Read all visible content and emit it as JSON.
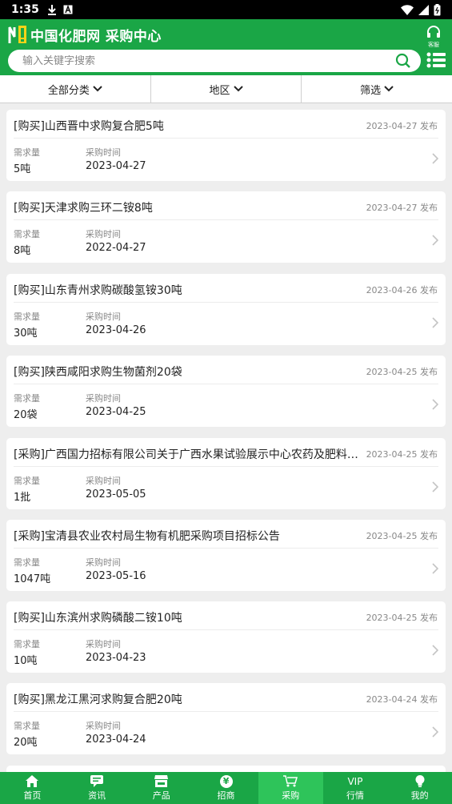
{
  "status": {
    "time": "1:35"
  },
  "header": {
    "title": "中国化肥网 采购中心",
    "service_label": "客服",
    "search_placeholder": "输入关键字搜索",
    "brand_color": "#1aa646"
  },
  "filters": [
    {
      "label": "全部分类"
    },
    {
      "label": "地区"
    },
    {
      "label": "筛选"
    }
  ],
  "list_labels": {
    "qty": "需求量",
    "time": "采购时间"
  },
  "items": [
    {
      "title": "[购买]山西晋中求购复合肥5吨",
      "date": "2023-04-27 发布",
      "qty": "5吨",
      "time": "2023-04-27"
    },
    {
      "title": "[购买]天津求购三环二铵8吨",
      "date": "2023-04-27 发布",
      "qty": "8吨",
      "time": "2022-04-27"
    },
    {
      "title": "[购买]山东青州求购碳酸氢铵30吨",
      "date": "2023-04-26 发布",
      "qty": "30吨",
      "time": "2023-04-26"
    },
    {
      "title": "[购买]陕西咸阳求购生物菌剂20袋",
      "date": "2023-04-25 发布",
      "qty": "20袋",
      "time": "2023-04-25"
    },
    {
      "title": "[采购]广西国力招标有限公司关于广西水果试验展示中心农药及肥料…",
      "date": "2023-04-25 发布",
      "qty": "1批",
      "time": "2023-05-05"
    },
    {
      "title": "[采购]宝清县农业农村局生物有机肥采购项目招标公告",
      "date": "2023-04-25 发布",
      "qty": "1047吨",
      "time": "2023-05-16"
    },
    {
      "title": "[购买]山东滨州求购磷酸二铵10吨",
      "date": "2023-04-25 发布",
      "qty": "10吨",
      "time": "2023-04-23"
    },
    {
      "title": "[购买]黑龙江黑河求购复合肥20吨",
      "date": "2023-04-24 发布",
      "qty": "20吨",
      "time": "2023-04-24"
    }
  ],
  "tabs": [
    {
      "label": "首页",
      "icon": "home-icon"
    },
    {
      "label": "资讯",
      "icon": "chat-icon"
    },
    {
      "label": "产品",
      "icon": "store-icon"
    },
    {
      "label": "招商",
      "icon": "yen-icon",
      "glyph": "¥"
    },
    {
      "label": "采购",
      "icon": "cart-icon",
      "active": true
    },
    {
      "label": "行情",
      "icon": "vip-icon",
      "glyph": "VIP"
    },
    {
      "label": "我的",
      "icon": "bulb-icon"
    }
  ]
}
